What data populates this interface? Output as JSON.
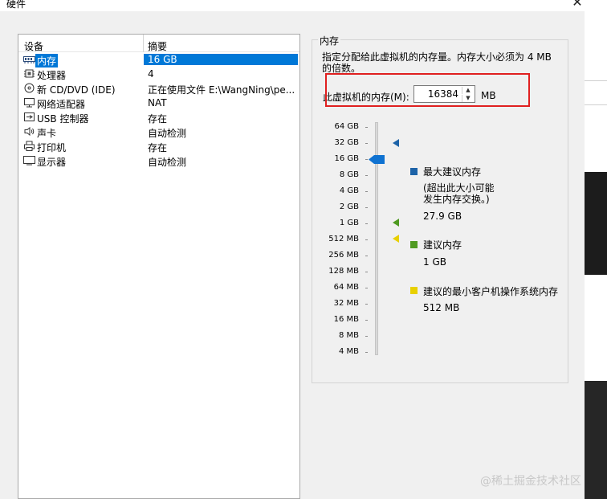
{
  "window": {
    "title": "硬件",
    "close_glyph": "✕"
  },
  "device_list": {
    "col_device": "设备",
    "col_summary": "摘要",
    "rows": [
      {
        "name": "内存",
        "summary": "16 GB",
        "icon": "memory-icon",
        "selected": true
      },
      {
        "name": "处理器",
        "summary": "4",
        "icon": "processor-icon"
      },
      {
        "name": "新 CD/DVD (IDE)",
        "summary": "正在使用文件 E:\\WangNing\\pe...",
        "icon": "cd-dvd-icon"
      },
      {
        "name": "网络适配器",
        "summary": "NAT",
        "icon": "network-adapter-icon"
      },
      {
        "name": "USB 控制器",
        "summary": "存在",
        "icon": "usb-icon"
      },
      {
        "name": "声卡",
        "summary": "自动检测",
        "icon": "sound-card-icon"
      },
      {
        "name": "打印机",
        "summary": "存在",
        "icon": "printer-icon"
      },
      {
        "name": "显示器",
        "summary": "自动检测",
        "icon": "display-icon"
      }
    ]
  },
  "memory": {
    "group_label": "内存",
    "description": "指定分配给此虚拟机的内存量。内存大小必须为 4 MB 的倍数。",
    "field_label": "此虚拟机的内存(M):",
    "field_value": "16384",
    "unit": "MB",
    "scale_labels": [
      "64 GB",
      "32 GB",
      "16 GB",
      "8 GB",
      "4 GB",
      "2 GB",
      "1 GB",
      "512 MB",
      "256 MB",
      "128 MB",
      "64 MB",
      "32 MB",
      "16 MB",
      "8 MB",
      "4 MB"
    ],
    "legend": {
      "max_title": "最大建议内存",
      "max_note_1": "(超出此大小可能",
      "max_note_2": "发生内存交换。)",
      "max_value": "27.9 GB",
      "rec_title": "建议内存",
      "rec_value": "1 GB",
      "min_title": "建议的最小客户机操作系统内存",
      "min_value": "512 MB"
    },
    "colors": {
      "max": "#1d63a8",
      "recommended": "#4f9a21",
      "min": "#e8d000",
      "highlight": "#e02020"
    }
  },
  "watermark": "@稀土掘金技术社区"
}
